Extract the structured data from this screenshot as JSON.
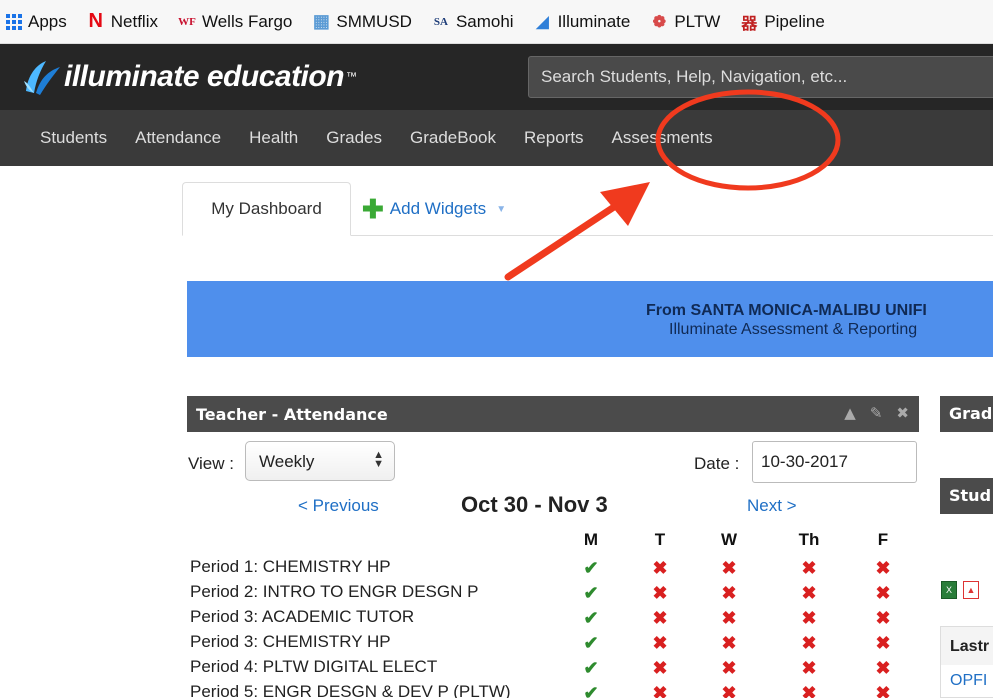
{
  "bookmarks": [
    {
      "label": "Apps",
      "icon": "apps-grid-icon",
      "color": "#1a73e8"
    },
    {
      "label": "Netflix",
      "icon": "netflix-icon",
      "glyph": "N",
      "color": "#e50914"
    },
    {
      "label": "Wells Fargo",
      "icon": "wells-fargo-icon",
      "glyph": "WF",
      "color": "#c8102e"
    },
    {
      "label": "SMMUSD",
      "icon": "smmusd-icon",
      "glyph": "▦",
      "color": "#5b9bd5"
    },
    {
      "label": "Samohi",
      "icon": "samohi-icon",
      "glyph": "SA",
      "color": "#1d3c78"
    },
    {
      "label": "Illuminate",
      "icon": "illuminate-icon",
      "glyph": "◢",
      "color": "#2f7fd8"
    },
    {
      "label": "PLTW",
      "icon": "pltw-icon",
      "glyph": "❁",
      "color": "#d84a4a"
    },
    {
      "label": "Pipeline",
      "icon": "pipeline-icon",
      "glyph": "器",
      "color": "#c02020"
    }
  ],
  "header": {
    "logo_text": "illuminate education",
    "logo_tm": "™",
    "search_placeholder": "Search Students, Help, Navigation, etc..."
  },
  "nav": [
    "Students",
    "Attendance",
    "Health",
    "Grades",
    "GradeBook",
    "Reports",
    "Assessments"
  ],
  "tabs": {
    "dashboard": "My Dashboard",
    "add_widgets": "Add Widgets"
  },
  "banner": {
    "line1": "From SANTA MONICA-MALIBU UNIFI",
    "line2": "Illuminate Assessment & Reporting"
  },
  "widget": {
    "title": "Teacher - Attendance",
    "view_label": "View :",
    "view_value": "Weekly",
    "date_label": "Date :",
    "date_value": "10-30-2017",
    "prev": "< Previous",
    "next": "Next >",
    "week_title": "Oct 30 - Nov 3",
    "days": [
      "M",
      "T",
      "W",
      "Th",
      "F"
    ],
    "periods": [
      {
        "name": "Period 1: CHEMISTRY HP",
        "marks": [
          "check",
          "x",
          "x",
          "x",
          "x"
        ]
      },
      {
        "name": "Period 2: INTRO TO ENGR DESGN P",
        "marks": [
          "check",
          "x",
          "x",
          "x",
          "x"
        ]
      },
      {
        "name": "Period 3: ACADEMIC TUTOR",
        "marks": [
          "check",
          "x",
          "x",
          "x",
          "x"
        ]
      },
      {
        "name": "Period 3: CHEMISTRY HP",
        "marks": [
          "check",
          "x",
          "x",
          "x",
          "x"
        ]
      },
      {
        "name": "Period 4: PLTW DIGITAL ELECT",
        "marks": [
          "check",
          "x",
          "x",
          "x",
          "x"
        ]
      },
      {
        "name": "Period 5: ENGR DESGN & DEV P (PLTW)",
        "marks": [
          "check",
          "x",
          "x",
          "x",
          "x"
        ]
      }
    ]
  },
  "side": {
    "head1": "Grad",
    "head2": "Stud",
    "table_header": "Lastr",
    "table_cell": "OPFI"
  },
  "colors": {
    "check": "#2e8b2e",
    "x": "#d92020",
    "annotation": "#f03a1e"
  }
}
